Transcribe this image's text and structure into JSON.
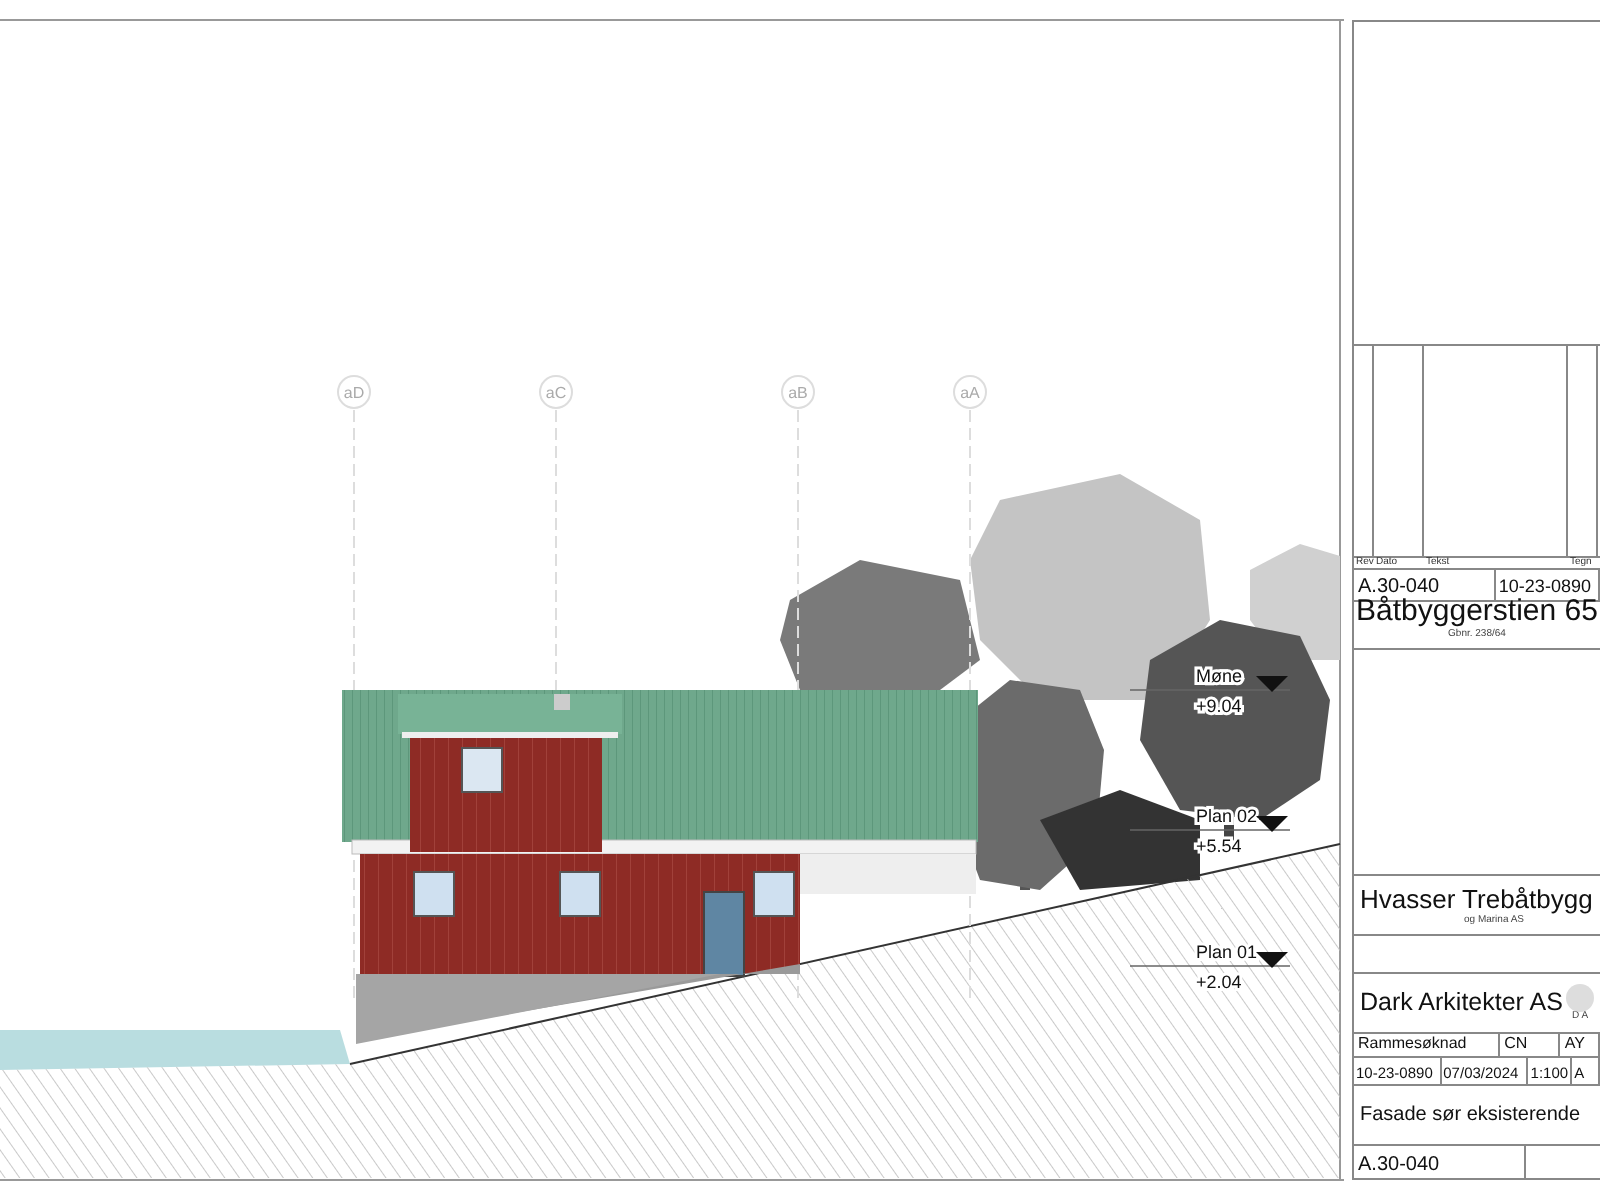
{
  "grid_lines": [
    {
      "label": "aD"
    },
    {
      "label": "aC"
    },
    {
      "label": "aB"
    },
    {
      "label": "aA"
    }
  ],
  "levels": [
    {
      "name": "Møne",
      "elevation": "+9.04"
    },
    {
      "name": "Plan 02",
      "elevation": "+5.54"
    },
    {
      "name": "Plan 01",
      "elevation": "+2.04"
    }
  ],
  "title_block": {
    "revision_columns": [
      "Rev",
      "Dato",
      "Tekst",
      "Tegn"
    ],
    "drawing_number": "A.30-040",
    "project_number": "10-23-0890",
    "project_name": "Båtbyggerstien 65",
    "property_number": "Gbnr. 238/64",
    "client": "Hvasser Trebåtbygg",
    "client_line_2": "og Marina AS",
    "architect": "Dark Arkitekter AS",
    "logo_text": "D A",
    "phase": "Rammesøknad",
    "drawn_by": "CN",
    "checked_by": "AY",
    "project_number_2": "10-23-0890",
    "date": "07/03/2024",
    "scale": "1:100",
    "sheet_size": "A",
    "drawing_title": "Fasade sør eksisterende",
    "drawing_number_2": "A.30-040"
  }
}
